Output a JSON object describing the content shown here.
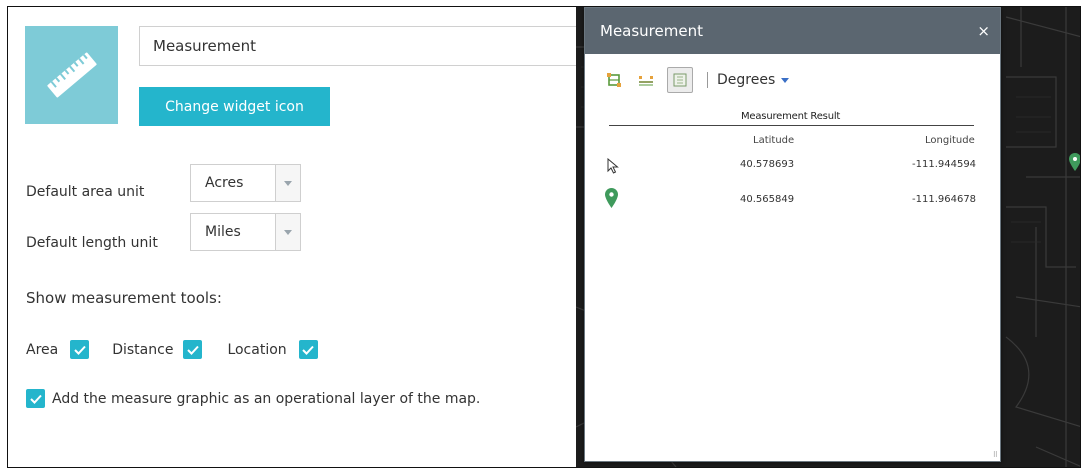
{
  "config": {
    "widget_name_value": "Measurement",
    "change_icon_label": "Change widget icon",
    "area_unit_label": "Default area unit",
    "area_unit_value": "Acres",
    "length_unit_label": "Default length unit",
    "length_unit_value": "Miles",
    "tools_title": "Show measurement tools:",
    "tool_area_label": "Area",
    "tool_distance_label": "Distance",
    "tool_location_label": "Location",
    "layer_option_label": "Add the measure graphic as an operational layer of the map.",
    "checked": {
      "area": true,
      "distance": true,
      "location": true,
      "layer": true
    }
  },
  "panel": {
    "title": "Measurement",
    "close_glyph": "×",
    "unit_dropdown": "Degrees",
    "tools": [
      "area-tool-icon",
      "distance-tool-icon",
      "location-tool-icon"
    ],
    "active_tool": "location-tool-icon",
    "result_title": "Measurement Result",
    "columns": {
      "latitude": "Latitude",
      "longitude": "Longitude"
    },
    "rows": [
      {
        "latitude": "40.578693",
        "longitude": "-111.944594",
        "marker": "cursor-icon"
      },
      {
        "latitude": "40.565849",
        "longitude": "-111.964678",
        "marker": "map-pin-icon"
      }
    ]
  },
  "colors": {
    "accent": "#24b5cc",
    "icon_tile": "#7ecbd7",
    "panel_header": "#5b6670",
    "map_bg": "#1c1c1c",
    "pin": "#3f9a5c"
  }
}
